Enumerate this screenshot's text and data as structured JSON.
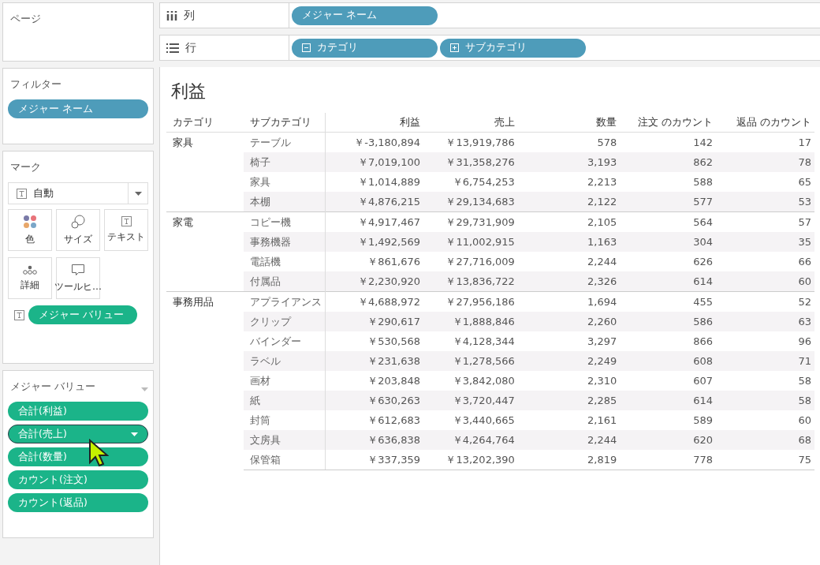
{
  "pages_card": {
    "title": "ページ"
  },
  "filters_card": {
    "title": "フィルター",
    "pills": [
      "メジャー ネーム"
    ]
  },
  "marks_card": {
    "title": "マーク",
    "mark_type": "自動",
    "buttons": [
      {
        "kind": "color",
        "label": "色"
      },
      {
        "kind": "size",
        "label": "サイズ"
      },
      {
        "kind": "text",
        "label": "テキスト"
      },
      {
        "kind": "detail",
        "label": "詳細"
      },
      {
        "kind": "tooltip",
        "label": "ツールヒ…"
      }
    ],
    "pills": [
      {
        "kind": "text",
        "label": "メジャー バリュー"
      }
    ]
  },
  "measure_values_card": {
    "title": "メジャー バリュー",
    "pills": [
      {
        "label": "合計(利益)",
        "selected": false
      },
      {
        "label": "合計(売上)",
        "selected": true
      },
      {
        "label": "合計(数量)",
        "selected": false
      },
      {
        "label": "カウント(注文)",
        "selected": false
      },
      {
        "label": "カウント(返品)",
        "selected": false
      }
    ]
  },
  "columns_shelf": {
    "label": "列",
    "pills": [
      {
        "label": "メジャー ネーム"
      }
    ]
  },
  "rows_shelf": {
    "label": "行",
    "pills": [
      {
        "kind": "collapse",
        "label": "カテゴリ"
      },
      {
        "kind": "expand",
        "label": "サブカテゴリ"
      }
    ]
  },
  "view": {
    "title": "利益",
    "columns": [
      "カテゴリ",
      "サブカテゴリ",
      "利益",
      "売上",
      "数量",
      "注文 のカウント",
      "返品 のカウント"
    ],
    "groups": [
      {
        "category": "家具",
        "rows": [
          {
            "subcategory": "テーブル",
            "values": [
              "￥-3,180,894",
              "￥13,919,786",
              "578",
              "142",
              "17"
            ]
          },
          {
            "subcategory": "椅子",
            "values": [
              "￥7,019,100",
              "￥31,358,276",
              "3,193",
              "862",
              "78"
            ]
          },
          {
            "subcategory": "家具",
            "values": [
              "￥1,014,889",
              "￥6,754,253",
              "2,213",
              "588",
              "65"
            ]
          },
          {
            "subcategory": "本棚",
            "values": [
              "￥4,876,215",
              "￥29,134,683",
              "2,122",
              "577",
              "53"
            ]
          }
        ]
      },
      {
        "category": "家電",
        "rows": [
          {
            "subcategory": "コピー機",
            "values": [
              "￥4,917,467",
              "￥29,731,909",
              "2,105",
              "564",
              "57"
            ]
          },
          {
            "subcategory": "事務機器",
            "values": [
              "￥1,492,569",
              "￥11,002,915",
              "1,163",
              "304",
              "35"
            ]
          },
          {
            "subcategory": "電話機",
            "values": [
              "￥861,676",
              "￥27,716,009",
              "2,244",
              "626",
              "66"
            ]
          },
          {
            "subcategory": "付属品",
            "values": [
              "￥2,230,920",
              "￥13,836,722",
              "2,326",
              "614",
              "60"
            ]
          }
        ]
      },
      {
        "category": "事務用品",
        "rows": [
          {
            "subcategory": "アプライアンス",
            "values": [
              "￥4,688,972",
              "￥27,956,186",
              "1,694",
              "455",
              "52"
            ]
          },
          {
            "subcategory": "クリップ",
            "values": [
              "￥290,617",
              "￥1,888,846",
              "2,260",
              "586",
              "63"
            ]
          },
          {
            "subcategory": "バインダー",
            "values": [
              "￥530,568",
              "￥4,128,344",
              "3,297",
              "866",
              "96"
            ]
          },
          {
            "subcategory": "ラベル",
            "values": [
              "￥231,638",
              "￥1,278,566",
              "2,249",
              "608",
              "71"
            ]
          },
          {
            "subcategory": "画材",
            "values": [
              "￥203,848",
              "￥3,842,080",
              "2,310",
              "607",
              "58"
            ]
          },
          {
            "subcategory": "紙",
            "values": [
              "￥630,263",
              "￥3,720,447",
              "2,285",
              "614",
              "58"
            ]
          },
          {
            "subcategory": "封筒",
            "values": [
              "￥612,683",
              "￥3,440,665",
              "2,161",
              "589",
              "60"
            ]
          },
          {
            "subcategory": "文房具",
            "values": [
              "￥636,838",
              "￥4,264,764",
              "2,244",
              "620",
              "68"
            ]
          },
          {
            "subcategory": "保管箱",
            "values": [
              "￥337,359",
              "￥13,202,390",
              "2,819",
              "778",
              "75"
            ]
          }
        ]
      }
    ]
  }
}
